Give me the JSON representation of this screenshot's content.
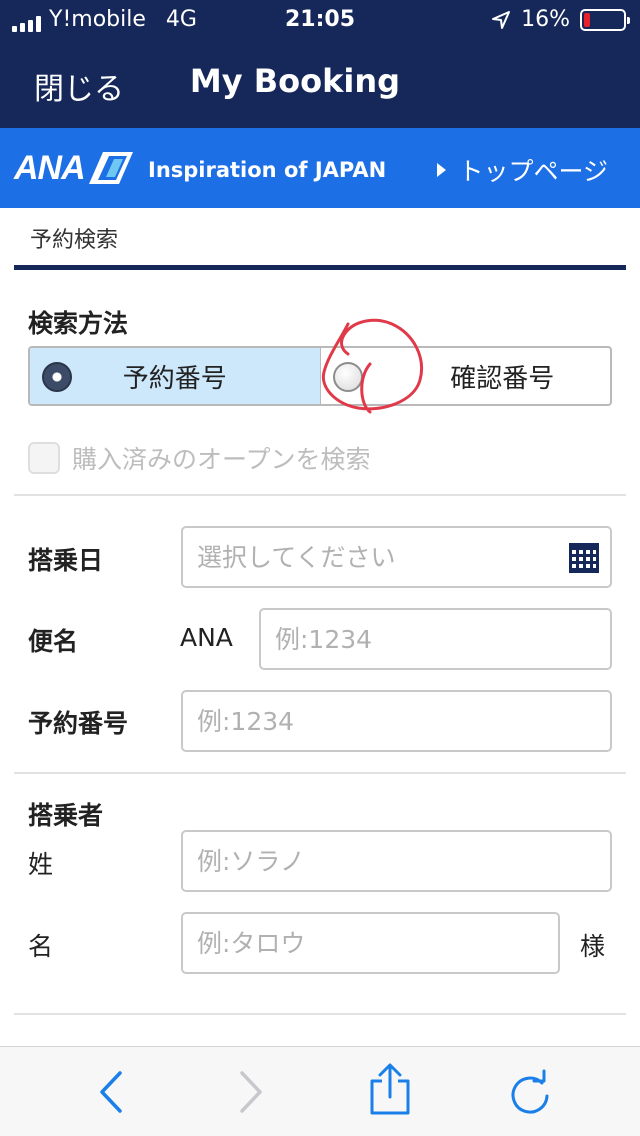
{
  "status_bar": {
    "carrier": "Y!mobile",
    "network": "4G",
    "time": "21:05",
    "battery": "16%",
    "battery_level": 0.16,
    "battery_color": "#e8202a"
  },
  "nav": {
    "close_label": "閉じる",
    "title": "My Booking"
  },
  "header": {
    "logo_text": "ANA",
    "tagline": "Inspiration of JAPAN",
    "top_link": "トップページ",
    "brand_color": "#1d6fe6",
    "navy_color": "#16285a"
  },
  "tab": {
    "label": "予約検索"
  },
  "search_method": {
    "label": "検索方法",
    "options": [
      {
        "label": "予約番号",
        "selected": true
      },
      {
        "label": "確認番号",
        "selected": false
      }
    ],
    "purchased_open_label": "購入済みのオープンを検索"
  },
  "form": {
    "boarding_date": {
      "label": "搭乗日",
      "placeholder": "選択してください",
      "icon": "calendar-icon"
    },
    "flight": {
      "label": "便名",
      "prefix": "ANA",
      "placeholder": "例:1234"
    },
    "booking_number": {
      "label": "予約番号",
      "placeholder": "例:1234"
    }
  },
  "passenger": {
    "label": "搭乗者",
    "last_name": {
      "label": "姓",
      "placeholder": "例:ソラノ"
    },
    "first_name": {
      "label": "名",
      "placeholder": "例:タロウ"
    },
    "honorific": "様"
  },
  "toolbar": {
    "icons": [
      "back-icon",
      "forward-icon",
      "share-icon",
      "reload-icon"
    ]
  }
}
